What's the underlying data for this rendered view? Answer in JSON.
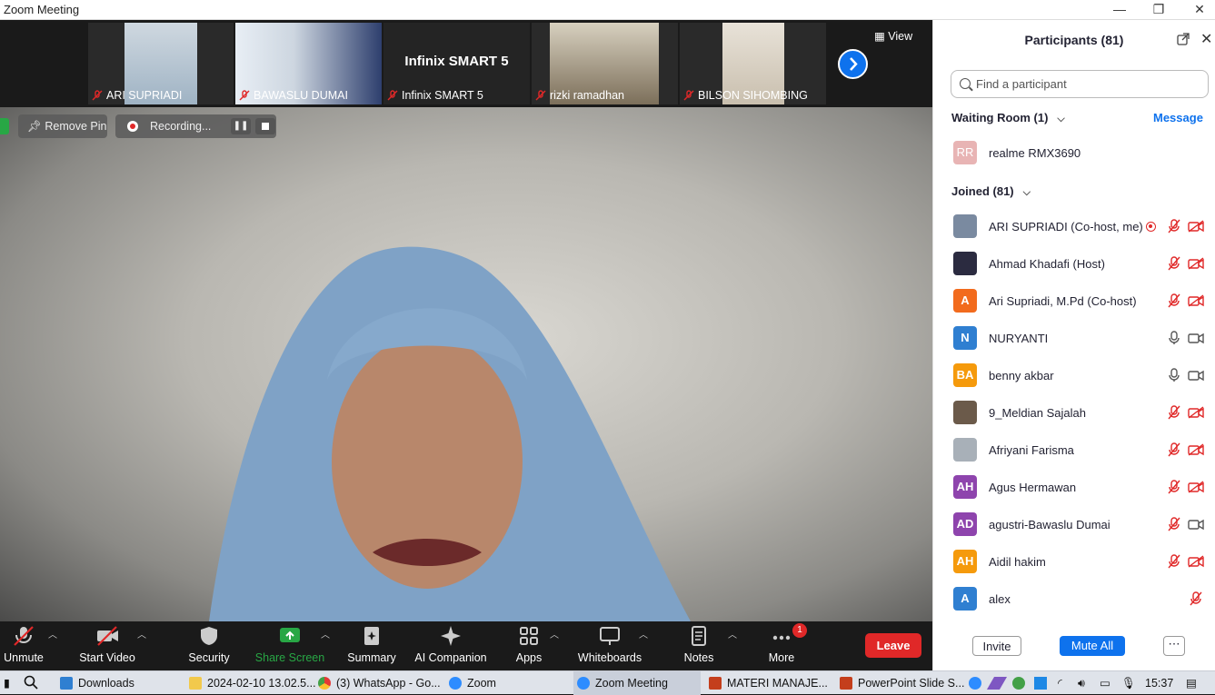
{
  "window": {
    "title": "Zoom Meeting"
  },
  "thumbnails": [
    {
      "name": "ARI SUPRIADI"
    },
    {
      "name": "BAWASLU DUMAI"
    },
    {
      "name": "Infinix SMART 5",
      "big_label": "Infinix SMART 5"
    },
    {
      "name": "rizki ramadhan"
    },
    {
      "name": "BILSON SIHOMBING"
    }
  ],
  "view_label": "View",
  "pin_label": "Remove Pin",
  "recording_label": "Recording...",
  "toolbar": {
    "unmute": "Unmute",
    "start_video": "Start Video",
    "security": "Security",
    "share_screen": "Share Screen",
    "summary": "Summary",
    "ai_companion": "AI Companion",
    "apps": "Apps",
    "whiteboards": "Whiteboards",
    "notes": "Notes",
    "more": "More",
    "more_badge": "1",
    "leave": "Leave"
  },
  "panel": {
    "title": "Participants (81)",
    "search_placeholder": "Find a participant",
    "waiting_room": "Waiting Room (1)",
    "message": "Message",
    "waiting": [
      {
        "initials": "RR",
        "name": "realme RMX3690",
        "color": "#e8b4b4"
      }
    ],
    "joined": "Joined (81)",
    "participants": [
      {
        "initials": "",
        "name": "ARI SUPRIADI (Co-host, me)",
        "color": "#7a8aa0",
        "photo": true,
        "mic": "off",
        "cam": "off",
        "rec": true
      },
      {
        "initials": "",
        "name": "Ahmad Khadafi (Host)",
        "color": "#2b2b40",
        "photo": true,
        "mic": "off",
        "cam": "off"
      },
      {
        "initials": "A",
        "name": "Ari Supriadi, M.Pd (Co-host)",
        "color": "#f26b1d",
        "mic": "off",
        "cam": "off"
      },
      {
        "initials": "N",
        "name": "NURYANTI",
        "color": "#2f7fd1",
        "mic": "on",
        "cam": "on"
      },
      {
        "initials": "BA",
        "name": "benny akbar",
        "color": "#f59a0c",
        "mic": "on",
        "cam": "on"
      },
      {
        "initials": "",
        "name": "9_Meldian Sajalah",
        "color": "#6b5a4a",
        "photo": true,
        "mic": "off",
        "cam": "off"
      },
      {
        "initials": "",
        "name": "Afriyani Farisma",
        "color": "#a8b0b8",
        "photo": true,
        "mic": "off",
        "cam": "off"
      },
      {
        "initials": "AH",
        "name": "Agus Hermawan",
        "color": "#8e44ad",
        "mic": "off",
        "cam": "off"
      },
      {
        "initials": "AD",
        "name": "agustri-Bawaslu Dumai",
        "color": "#8e44ad",
        "mic": "off",
        "cam": "on"
      },
      {
        "initials": "AH",
        "name": "Aidil hakim",
        "color": "#f59a0c",
        "mic": "off",
        "cam": "off"
      },
      {
        "initials": "A",
        "name": "alex",
        "color": "#2f7fd1",
        "mic": "off",
        "cam": "none"
      }
    ],
    "invite": "Invite",
    "mute_all": "Mute All"
  },
  "taskbar": {
    "items": [
      {
        "label": "Downloads"
      },
      {
        "label": "2024-02-10 13.02.5..."
      },
      {
        "label": "(3) WhatsApp - Go..."
      },
      {
        "label": "Zoom"
      },
      {
        "label": "Zoom Meeting"
      },
      {
        "label": "MATERI MANAJE..."
      },
      {
        "label": "PowerPoint Slide S..."
      }
    ],
    "clock": "15:37"
  },
  "colors": {
    "accent": "#0e72ed",
    "leave": "#e02828",
    "share": "#28a745",
    "muted": "#e02828"
  }
}
